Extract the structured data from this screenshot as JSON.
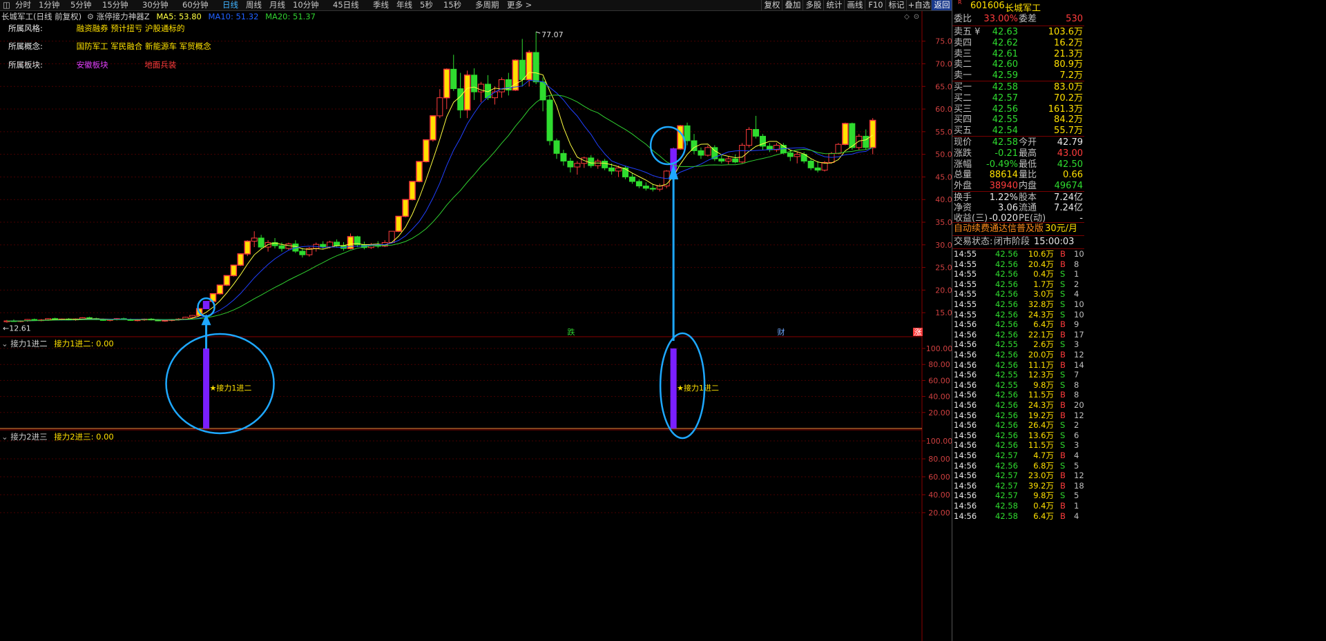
{
  "toolbar": {
    "periods": [
      "分时",
      "1分钟",
      "5分钟",
      "15分钟",
      "30分钟",
      "60分钟",
      "日线",
      "周线",
      "月线",
      "10分钟",
      "45日线",
      "季线",
      "年线",
      "5秒",
      "15秒",
      "多周期",
      "更多 >"
    ],
    "active_period": "日线",
    "right_buttons": [
      "复权",
      "叠加",
      "多股",
      "统计",
      "画线",
      "F10",
      "标记",
      "+自选",
      "返回"
    ]
  },
  "main_chart": {
    "title": "长城军工(日线 前复权)",
    "indicator_name": "涨停接力神器Z",
    "ma5_label": "MA5: 53.80",
    "ma10_label": "MA10: 51.32",
    "ma20_label": "MA20: 51.37",
    "info": [
      {
        "label": "所属风格:",
        "values": [
          "融资融券 预计扭亏 沪股通标的"
        ],
        "color": "#ffe000"
      },
      {
        "label": "所属概念:",
        "values": [
          "国防军工 军民融合 新能源车 军贸概念"
        ],
        "color": "#ffe000"
      },
      {
        "label": "所属板块:",
        "values": [
          "安徽板块",
          "地面兵装"
        ],
        "colors": [
          "#e040ff",
          "#ff3c3c"
        ]
      }
    ],
    "y_labels": [
      "75.00",
      "70.00",
      "65.00",
      "60.00",
      "55.00",
      "50.00",
      "45.00",
      "40.00",
      "35.00",
      "30.00",
      "25.00",
      "20.00",
      "15.00"
    ],
    "high_marker": "77.07",
    "low_marker": "12.61",
    "events": [
      "跌",
      "财",
      "涨"
    ]
  },
  "sub1": {
    "title": "接力1进二",
    "value_label": "接力1进二: 0.00",
    "y_labels": [
      "100.00",
      "80.00",
      "60.00",
      "40.00",
      "20.00"
    ],
    "signal_label": "★接力1进二"
  },
  "sub2": {
    "title": "接力2进三",
    "value_label": "接力2进三: 0.00",
    "y_labels": [
      "100.00",
      "80.00",
      "60.00",
      "40.00",
      "20.00"
    ]
  },
  "colors": {
    "up": "#ff3c3c",
    "down": "#2fdc2f",
    "ma5": "#ffff40",
    "ma10": "#2040ff",
    "ma20": "#30d030",
    "signal": "#7a1fff",
    "annotation": "#1ea8ff"
  },
  "quote": {
    "code_prefix": "R",
    "code": "601606",
    "name": "长城军工",
    "ratio_label": "委比",
    "ratio": "33.00%",
    "diff_label": "委差",
    "diff": "530",
    "asks": [
      {
        "label": "卖五 ¥",
        "price": "42.63",
        "vol": "103.6万"
      },
      {
        "label": "卖四",
        "price": "42.62",
        "vol": "16.2万"
      },
      {
        "label": "卖三",
        "price": "42.61",
        "vol": "21.3万"
      },
      {
        "label": "卖二",
        "price": "42.60",
        "vol": "80.9万"
      },
      {
        "label": "卖一",
        "price": "42.59",
        "vol": "7.2万"
      }
    ],
    "bids": [
      {
        "label": "买一",
        "price": "42.58",
        "vol": "83.0万"
      },
      {
        "label": "买二",
        "price": "42.57",
        "vol": "70.2万"
      },
      {
        "label": "买三",
        "price": "42.56",
        "vol": "161.3万"
      },
      {
        "label": "买四",
        "price": "42.55",
        "vol": "84.2万"
      },
      {
        "label": "买五",
        "price": "42.54",
        "vol": "55.7万"
      }
    ],
    "stats": [
      {
        "l1": "现价",
        "v1": "42.58",
        "c1": "green",
        "l2": "今开",
        "v2": "42.79",
        "c2": "white"
      },
      {
        "l1": "涨跌",
        "v1": "-0.21",
        "c1": "green",
        "l2": "最高",
        "v2": "43.00",
        "c2": "red"
      },
      {
        "l1": "涨幅",
        "v1": "-0.49%",
        "c1": "green",
        "l2": "最低",
        "v2": "42.50",
        "c2": "green"
      },
      {
        "l1": "总量",
        "v1": "88614",
        "c1": "yellow",
        "l2": "量比",
        "v2": "0.66",
        "c2": "yellow"
      },
      {
        "l1": "外盘",
        "v1": "38940",
        "c1": "red",
        "l2": "内盘",
        "v2": "49674",
        "c2": "green"
      }
    ],
    "stats2": [
      {
        "l1": "换手",
        "v1": "1.22%",
        "c1": "white",
        "l2": "股本",
        "v2": "7.24亿",
        "c2": "white"
      },
      {
        "l1": "净资",
        "v1": "3.06",
        "c1": "white",
        "l2": "流通",
        "v2": "7.24亿",
        "c2": "white"
      },
      {
        "l1": "收益(三)",
        "v1": "-0.020",
        "c1": "white",
        "l2": "PE(动)",
        "v2": "-",
        "c2": "white"
      }
    ],
    "promo": "自动续费通达信普及版",
    "promo_price": "30元/月",
    "trade_state_label": "交易状态:",
    "trade_state": "闭市阶段",
    "trade_time": "15:00:03"
  },
  "ticks": [
    {
      "t": "14:55",
      "p": "42.56",
      "v": "10.6万",
      "d": "B",
      "n": "10"
    },
    {
      "t": "14:55",
      "p": "42.56",
      "v": "20.4万",
      "d": "B",
      "n": "8"
    },
    {
      "t": "14:55",
      "p": "42.56",
      "v": "0.4万",
      "d": "S",
      "n": "1"
    },
    {
      "t": "14:55",
      "p": "42.56",
      "v": "1.7万",
      "d": "S",
      "n": "2"
    },
    {
      "t": "14:55",
      "p": "42.56",
      "v": "3.0万",
      "d": "S",
      "n": "4"
    },
    {
      "t": "14:55",
      "p": "42.56",
      "v": "32.8万",
      "d": "S",
      "n": "10"
    },
    {
      "t": "14:55",
      "p": "42.56",
      "v": "24.3万",
      "d": "S",
      "n": "10"
    },
    {
      "t": "14:56",
      "p": "42.56",
      "v": "6.4万",
      "d": "B",
      "n": "9"
    },
    {
      "t": "14:56",
      "p": "42.56",
      "v": "22.1万",
      "d": "B",
      "n": "17"
    },
    {
      "t": "14:56",
      "p": "42.55",
      "v": "2.6万",
      "d": "S",
      "n": "3"
    },
    {
      "t": "14:56",
      "p": "42.56",
      "v": "20.0万",
      "d": "B",
      "n": "12"
    },
    {
      "t": "14:56",
      "p": "42.56",
      "v": "11.1万",
      "d": "B",
      "n": "14"
    },
    {
      "t": "14:56",
      "p": "42.55",
      "v": "12.3万",
      "d": "S",
      "n": "7"
    },
    {
      "t": "14:56",
      "p": "42.55",
      "v": "9.8万",
      "d": "S",
      "n": "8"
    },
    {
      "t": "14:56",
      "p": "42.56",
      "v": "11.5万",
      "d": "B",
      "n": "8"
    },
    {
      "t": "14:56",
      "p": "42.56",
      "v": "24.3万",
      "d": "B",
      "n": "20"
    },
    {
      "t": "14:56",
      "p": "42.56",
      "v": "19.2万",
      "d": "B",
      "n": "12"
    },
    {
      "t": "14:56",
      "p": "42.56",
      "v": "26.4万",
      "d": "S",
      "n": "2"
    },
    {
      "t": "14:56",
      "p": "42.56",
      "v": "13.6万",
      "d": "S",
      "n": "6"
    },
    {
      "t": "14:56",
      "p": "42.56",
      "v": "11.5万",
      "d": "S",
      "n": "3"
    },
    {
      "t": "14:56",
      "p": "42.57",
      "v": "4.7万",
      "d": "B",
      "n": "4"
    },
    {
      "t": "14:56",
      "p": "42.56",
      "v": "6.8万",
      "d": "S",
      "n": "5"
    },
    {
      "t": "14:56",
      "p": "42.57",
      "v": "23.0万",
      "d": "B",
      "n": "12"
    },
    {
      "t": "14:56",
      "p": "42.57",
      "v": "39.2万",
      "d": "B",
      "n": "18"
    },
    {
      "t": "14:56",
      "p": "42.57",
      "v": "9.8万",
      "d": "S",
      "n": "5"
    },
    {
      "t": "14:56",
      "p": "42.58",
      "v": "0.4万",
      "d": "B",
      "n": "1"
    },
    {
      "t": "14:56",
      "p": "42.58",
      "v": "6.4万",
      "d": "B",
      "n": "4"
    }
  ],
  "chart_data": {
    "type": "candlestick",
    "ylim": [
      10,
      78
    ],
    "candles": [
      [
        13.0,
        13.4,
        12.8,
        13.2
      ],
      [
        13.2,
        13.5,
        13.0,
        13.1
      ],
      [
        13.1,
        13.3,
        12.9,
        13.2
      ],
      [
        13.2,
        13.6,
        13.0,
        13.5
      ],
      [
        13.5,
        13.7,
        13.2,
        13.3
      ],
      [
        13.3,
        13.6,
        13.1,
        13.4
      ],
      [
        13.4,
        13.8,
        13.2,
        13.7
      ],
      [
        13.7,
        13.9,
        13.4,
        13.5
      ],
      [
        13.5,
        13.7,
        13.3,
        13.6
      ],
      [
        13.6,
        13.8,
        13.3,
        13.4
      ],
      [
        13.4,
        13.7,
        13.2,
        13.6
      ],
      [
        13.6,
        14.0,
        13.5,
        13.9
      ],
      [
        13.9,
        14.1,
        13.6,
        13.7
      ],
      [
        13.7,
        13.9,
        13.4,
        13.5
      ],
      [
        13.5,
        13.7,
        13.2,
        13.3
      ],
      [
        13.3,
        13.6,
        13.1,
        13.5
      ],
      [
        13.5,
        13.8,
        13.3,
        13.7
      ],
      [
        13.7,
        13.9,
        13.4,
        13.5
      ],
      [
        13.5,
        13.7,
        13.2,
        13.3
      ],
      [
        13.3,
        13.6,
        13.1,
        13.4
      ],
      [
        13.4,
        13.7,
        13.2,
        13.6
      ],
      [
        13.6,
        13.8,
        13.3,
        13.4
      ],
      [
        13.4,
        13.6,
        13.1,
        13.2
      ],
      [
        13.2,
        13.5,
        13.0,
        13.3
      ],
      [
        13.3,
        13.6,
        13.1,
        13.5
      ],
      [
        13.5,
        13.8,
        13.3,
        13.6
      ],
      [
        13.6,
        14.1,
        13.4,
        14.0
      ],
      [
        14.0,
        14.5,
        13.8,
        14.4
      ],
      [
        14.4,
        16.0,
        14.3,
        15.9
      ],
      [
        15.9,
        17.5,
        15.8,
        17.5
      ],
      [
        17.5,
        19.3,
        17.4,
        19.2
      ],
      [
        19.2,
        21.2,
        19.0,
        21.1
      ],
      [
        21.1,
        23.2,
        20.9,
        23.2
      ],
      [
        23.2,
        25.5,
        23.0,
        25.5
      ],
      [
        25.5,
        28.1,
        25.3,
        28.0
      ],
      [
        28.0,
        31.0,
        27.5,
        30.8
      ],
      [
        30.8,
        33.0,
        29.5,
        31.5
      ],
      [
        31.5,
        32.2,
        29.0,
        29.5
      ],
      [
        29.5,
        31.0,
        28.5,
        30.5
      ],
      [
        30.5,
        31.5,
        29.2,
        29.8
      ],
      [
        29.8,
        30.5,
        28.5,
        29.2
      ],
      [
        29.2,
        30.5,
        28.8,
        30.2
      ],
      [
        30.2,
        31.0,
        28.2,
        28.6
      ],
      [
        28.6,
        29.3,
        27.2,
        27.8
      ],
      [
        27.8,
        29.5,
        27.4,
        29.2
      ],
      [
        29.2,
        30.5,
        28.5,
        30.1
      ],
      [
        30.1,
        30.8,
        29.0,
        29.5
      ],
      [
        29.5,
        30.9,
        29.2,
        30.6
      ],
      [
        30.6,
        31.2,
        29.4,
        29.8
      ],
      [
        29.8,
        30.6,
        28.7,
        29.2
      ],
      [
        29.2,
        32.5,
        29.0,
        31.8
      ],
      [
        31.8,
        32.0,
        29.5,
        30.0
      ],
      [
        30.0,
        30.7,
        29.0,
        29.4
      ],
      [
        29.4,
        30.4,
        29.1,
        30.0
      ],
      [
        30.0,
        30.8,
        29.3,
        29.7
      ],
      [
        29.7,
        31.0,
        29.5,
        30.5
      ],
      [
        30.5,
        33.0,
        30.3,
        33.0
      ],
      [
        33.0,
        36.3,
        32.8,
        36.3
      ],
      [
        36.3,
        40.0,
        36.1,
        40.0
      ],
      [
        40.0,
        44.0,
        39.8,
        44.0
      ],
      [
        44.0,
        48.4,
        43.8,
        48.4
      ],
      [
        48.4,
        53.2,
        48.2,
        53.2
      ],
      [
        53.2,
        58.5,
        52.8,
        58.5
      ],
      [
        58.5,
        64.4,
        58.0,
        62.5
      ],
      [
        62.5,
        69.0,
        60.0,
        68.8
      ],
      [
        68.8,
        72.0,
        64.0,
        64.5
      ],
      [
        64.5,
        68.0,
        58.0,
        59.8
      ],
      [
        59.8,
        68.5,
        58.0,
        67.5
      ],
      [
        67.5,
        69.0,
        62.0,
        63.8
      ],
      [
        63.8,
        66.0,
        61.5,
        65.5
      ],
      [
        65.5,
        67.5,
        62.0,
        62.5
      ],
      [
        62.5,
        65.0,
        61.0,
        63.8
      ],
      [
        63.8,
        67.0,
        62.5,
        66.5
      ],
      [
        66.5,
        68.0,
        63.0,
        64.2
      ],
      [
        64.2,
        71.0,
        64.0,
        70.8
      ],
      [
        70.8,
        75.5,
        65.0,
        66.5
      ],
      [
        66.5,
        73.0,
        65.0,
        72.5
      ],
      [
        72.5,
        77.07,
        65.5,
        66.0
      ],
      [
        66.0,
        67.0,
        59.5,
        62.0
      ],
      [
        62.0,
        63.0,
        52.0,
        53.0
      ],
      [
        53.0,
        53.5,
        49.0,
        50.2
      ],
      [
        50.2,
        51.0,
        47.5,
        48.5
      ],
      [
        48.5,
        49.2,
        46.0,
        47.2
      ],
      [
        47.2,
        48.5,
        45.5,
        48.0
      ],
      [
        48.0,
        49.5,
        47.0,
        49.2
      ],
      [
        49.2,
        49.8,
        47.0,
        47.5
      ],
      [
        47.5,
        49.0,
        46.8,
        48.5
      ],
      [
        48.5,
        49.0,
        46.5,
        47.0
      ],
      [
        47.0,
        48.0,
        45.5,
        46.3
      ],
      [
        46.3,
        47.5,
        45.0,
        47.0
      ],
      [
        47.0,
        47.5,
        44.5,
        45.0
      ],
      [
        45.0,
        45.8,
        43.5,
        44.0
      ],
      [
        44.0,
        44.5,
        42.5,
        43.0
      ],
      [
        43.0,
        43.8,
        42.0,
        42.5
      ],
      [
        42.5,
        43.5,
        41.8,
        42.3
      ],
      [
        42.3,
        43.5,
        41.8,
        43.0
      ],
      [
        43.0,
        46.5,
        42.5,
        46.3
      ],
      [
        46.3,
        51.5,
        46.0,
        51.2
      ],
      [
        51.2,
        56.5,
        51.0,
        56.3
      ],
      [
        56.3,
        57.0,
        52.0,
        53.0
      ],
      [
        53.0,
        54.5,
        50.0,
        50.8
      ],
      [
        50.8,
        51.5,
        49.0,
        49.8
      ],
      [
        49.8,
        52.0,
        49.5,
        51.5
      ],
      [
        51.5,
        52.0,
        48.5,
        49.0
      ],
      [
        49.0,
        50.0,
        48.0,
        48.5
      ],
      [
        48.5,
        49.5,
        47.8,
        49.0
      ],
      [
        49.0,
        50.0,
        48.0,
        48.3
      ],
      [
        48.3,
        52.5,
        48.0,
        52.0
      ],
      [
        52.0,
        56.0,
        51.5,
        55.5
      ],
      [
        55.5,
        58.5,
        53.5,
        54.0
      ],
      [
        54.0,
        54.5,
        51.0,
        51.8
      ],
      [
        51.8,
        52.5,
        50.5,
        51.0
      ],
      [
        51.0,
        52.5,
        50.5,
        52.0
      ],
      [
        52.0,
        52.5,
        50.0,
        50.3
      ],
      [
        50.3,
        51.0,
        48.5,
        49.5
      ],
      [
        49.5,
        50.5,
        48.0,
        50.0
      ],
      [
        50.0,
        50.5,
        48.0,
        48.5
      ],
      [
        48.5,
        49.0,
        46.5,
        47.0
      ],
      [
        47.0,
        48.5,
        46.0,
        46.5
      ],
      [
        46.5,
        48.5,
        46.2,
        48.2
      ],
      [
        48.2,
        50.5,
        48.0,
        50.2
      ],
      [
        50.2,
        52.5,
        50.0,
        52.2
      ],
      [
        52.2,
        57.0,
        52.0,
        56.8
      ],
      [
        56.8,
        57.0,
        51.0,
        51.5
      ],
      [
        51.5,
        54.5,
        51.0,
        54.0
      ],
      [
        54.0,
        55.5,
        51.0,
        51.5
      ],
      [
        51.5,
        58.0,
        50.0,
        57.5
      ]
    ],
    "signal_indices": [
      29,
      97
    ],
    "signal_value": 100
  }
}
